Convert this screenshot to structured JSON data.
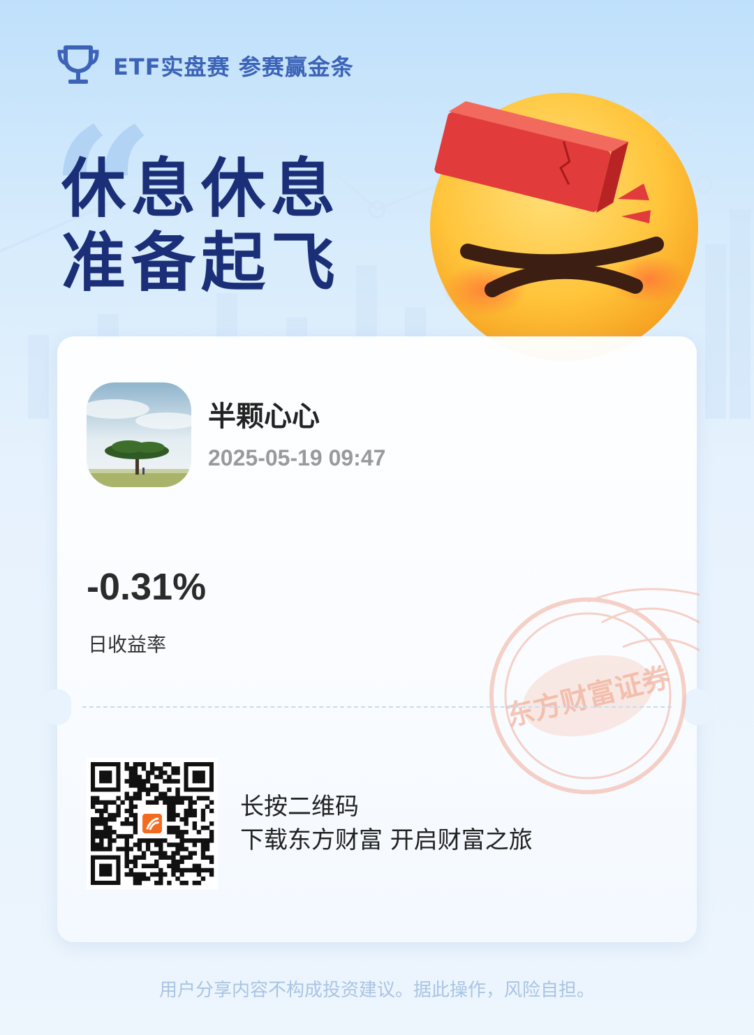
{
  "header": {
    "title": "ETF实盘赛 参赛赢金条",
    "icon": "trophy-icon",
    "color": "#3c63b8"
  },
  "headline": {
    "line1": "休息休息",
    "line2": "准备起飞",
    "color": "#1b2f78"
  },
  "mascot": {
    "icon": "dizzy-face-with-gold-bar-icon"
  },
  "card": {
    "user": {
      "name": "半颗心心",
      "timestamp": "2025-05-19 09:47"
    },
    "metric": {
      "value": "-0.31%",
      "label": "日收益率"
    },
    "stamp": {
      "text": "东方财富证券",
      "color": "#f2a58e"
    },
    "promo": {
      "line1": "长按二维码",
      "line2": "下载东方财富 开启财富之旅"
    }
  },
  "disclaimer": "用户分享内容不构成投资建议。据此操作，风险自担。"
}
